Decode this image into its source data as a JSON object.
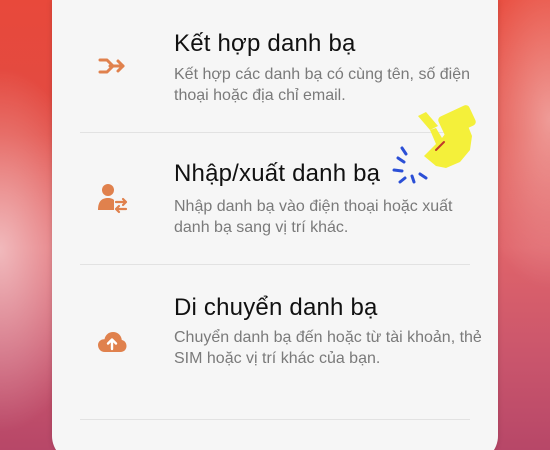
{
  "menu": {
    "items": [
      {
        "title": "Kết hợp danh bạ",
        "description": "Kết hợp các danh bạ có cùng tên, số điện thoại hoặc địa chỉ email.",
        "icon": "merge-icon"
      },
      {
        "title": "Nhập/xuất danh bạ",
        "description": "Nhập danh bạ vào điện thoại hoặc xuất danh bạ sang vị trí khác.",
        "icon": "import-export-contact-icon"
      },
      {
        "title": "Di chuyển danh bạ",
        "description": "Chuyển danh bạ đến hoặc từ tài khoản, thẻ SIM hoặc vị trí khác của bạn.",
        "icon": "cloud-upload-icon"
      }
    ]
  },
  "colors": {
    "accent_icon": "#e0814d",
    "pointer": "#f4f03a"
  }
}
